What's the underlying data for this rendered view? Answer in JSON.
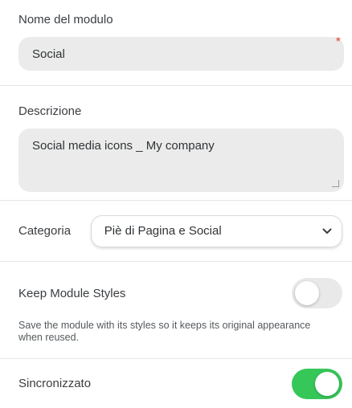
{
  "module_name": {
    "label": "Nome del modulo",
    "value": "Social",
    "required_mark": "*"
  },
  "description": {
    "label": "Descrizione",
    "value": "Social media icons _ My company"
  },
  "category": {
    "label": "Categoria",
    "selected": "Piè di Pagina e Social"
  },
  "keep_styles": {
    "label": "Keep Module Styles",
    "enabled": false,
    "help": "Save the module with its styles so it keeps its original appearance when reused."
  },
  "synchronized": {
    "label": "Sincronizzato",
    "enabled": true
  },
  "colors": {
    "toggle_on": "#36c759",
    "toggle_off": "#e9e9e9",
    "required": "#e0453a"
  }
}
